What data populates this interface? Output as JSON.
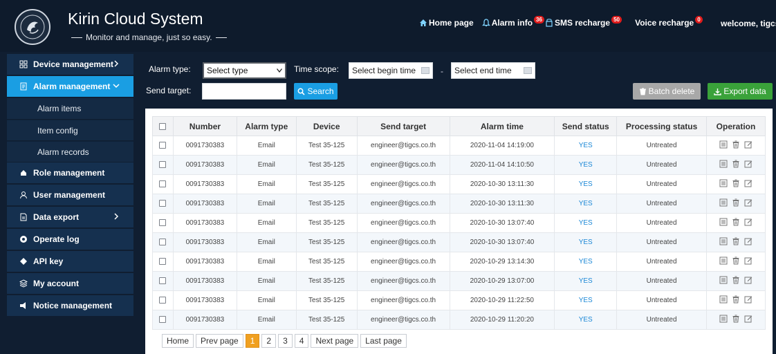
{
  "header": {
    "title": "Kirin Cloud System",
    "subtitle": "Monitor and manage, just so easy.",
    "nav": [
      {
        "label": "Home page",
        "icon": "home-icon",
        "badge": ""
      },
      {
        "label": "Alarm info",
        "icon": "bell-icon",
        "badge": "36"
      },
      {
        "label": "SMS recharge",
        "icon": "sms-icon",
        "badge": "50"
      },
      {
        "label": "Voice recharge",
        "icon": "",
        "badge": "0"
      }
    ],
    "welcome": "welcome, tigcs"
  },
  "sidebar": {
    "items": [
      {
        "label": "Device management",
        "icon": "grid-icon"
      },
      {
        "label": "Alarm management",
        "icon": "alarm-doc-icon"
      },
      {
        "label": "Role management",
        "icon": "role-icon"
      },
      {
        "label": "User management",
        "icon": "user-icon"
      },
      {
        "label": "Data export",
        "icon": "export-doc-icon"
      },
      {
        "label": "Operate log",
        "icon": "log-icon"
      },
      {
        "label": "API key",
        "icon": "key-icon"
      },
      {
        "label": "My account",
        "icon": "account-icon"
      },
      {
        "label": "Notice management",
        "icon": "notice-icon"
      }
    ],
    "sub_items": [
      "Alarm items",
      "Item config",
      "Alarm records"
    ]
  },
  "filters": {
    "alarm_type_label": "Alarm type:",
    "alarm_type_value": "Select type",
    "time_scope_label": "Time scope:",
    "begin_placeholder": "Select begin time",
    "dash": "-",
    "end_placeholder": "Select end time",
    "send_target_label": "Send target:",
    "send_target_value": "",
    "search_label": "Search",
    "batch_delete_label": "Batch delete",
    "export_label": "Export data"
  },
  "table": {
    "columns": [
      "Number",
      "Alarm type",
      "Device",
      "Send target",
      "Alarm time",
      "Send status",
      "Processing status",
      "Operation"
    ],
    "rows": [
      [
        "0091730383",
        "Email",
        "Test 35-125",
        "engineer@tigcs.co.th",
        "2020-11-04 14:19:00",
        "YES",
        "Untreated"
      ],
      [
        "0091730383",
        "Email",
        "Test 35-125",
        "engineer@tigcs.co.th",
        "2020-11-04 14:10:50",
        "YES",
        "Untreated"
      ],
      [
        "0091730383",
        "Email",
        "Test 35-125",
        "engineer@tigcs.co.th",
        "2020-10-30 13:11:30",
        "YES",
        "Untreated"
      ],
      [
        "0091730383",
        "Email",
        "Test 35-125",
        "engineer@tigcs.co.th",
        "2020-10-30 13:11:30",
        "YES",
        "Untreated"
      ],
      [
        "0091730383",
        "Email",
        "Test 35-125",
        "engineer@tigcs.co.th",
        "2020-10-30 13:07:40",
        "YES",
        "Untreated"
      ],
      [
        "0091730383",
        "Email",
        "Test 35-125",
        "engineer@tigcs.co.th",
        "2020-10-30 13:07:40",
        "YES",
        "Untreated"
      ],
      [
        "0091730383",
        "Email",
        "Test 35-125",
        "engineer@tigcs.co.th",
        "2020-10-29 13:14:30",
        "YES",
        "Untreated"
      ],
      [
        "0091730383",
        "Email",
        "Test 35-125",
        "engineer@tigcs.co.th",
        "2020-10-29 13:07:00",
        "YES",
        "Untreated"
      ],
      [
        "0091730383",
        "Email",
        "Test 35-125",
        "engineer@tigcs.co.th",
        "2020-10-29 11:22:50",
        "YES",
        "Untreated"
      ],
      [
        "0091730383",
        "Email",
        "Test 35-125",
        "engineer@tigcs.co.th",
        "2020-10-29 11:20:20",
        "YES",
        "Untreated"
      ]
    ]
  },
  "pager": {
    "home": "Home",
    "prev": "Prev page",
    "pages": [
      "1",
      "2",
      "3",
      "4"
    ],
    "current": "1",
    "next": "Next page",
    "last": "Last page"
  },
  "colors": {
    "accent": "#1a9ee3",
    "sidebar_bg": "#15304f",
    "page_bg": "#101e31",
    "batch_delete": "#a8a8a8",
    "export": "#3aa23a",
    "current_page": "#f0a020",
    "badge": "#e01c1c"
  }
}
